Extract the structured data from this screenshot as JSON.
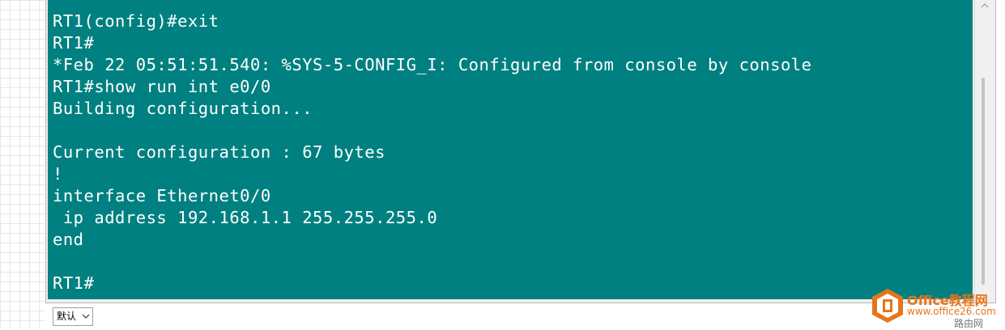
{
  "terminal": {
    "background_color": "#008080",
    "text_color": "#ffffff",
    "lines": [
      "RT1(config)#exit",
      "RT1#",
      "*Feb 22 05:51:51.540: %SYS-5-CONFIG_I: Configured from console by console",
      "RT1#show run int e0/0",
      "Building configuration...",
      "",
      "Current configuration : 67 bytes",
      "!",
      "interface Ethernet0/0",
      " ip address 192.168.1.1 255.255.255.0",
      "end",
      "",
      "RT1#"
    ]
  },
  "encoding_select": {
    "value": "默认",
    "icon": "chevron-down-icon"
  },
  "watermark": {
    "brand": "Office教程网",
    "url": "www.office26.com",
    "sub": "路由网",
    "logo_icon": "office-logo-icon",
    "color": "#e8741a"
  }
}
